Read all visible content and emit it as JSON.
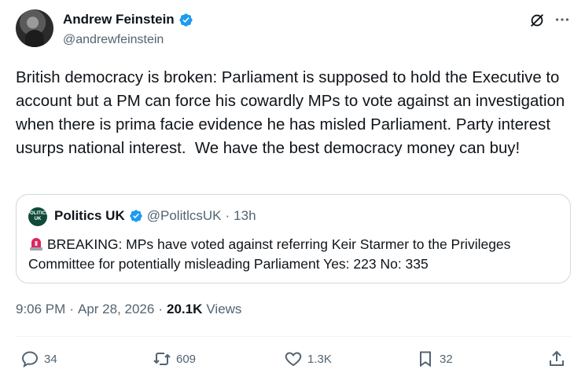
{
  "author": {
    "name": "Andrew Feinstein",
    "handle": "@andrewfeinstein"
  },
  "tweet": {
    "text": "British democracy is broken: Parliament is supposed to hold the Executive to account but a PM can force his cowardly MPs to vote against an investigation when there is prima facie evidence he has misled Parliament. Party interest usurps national interest.  We have the best democracy money can buy!"
  },
  "quote": {
    "avatar_text": "POLITICS UK",
    "name": "Politics UK",
    "handle": "@PolitlcsUK",
    "separator": "·",
    "time": "13h",
    "text": "BREAKING: MPs have voted against referring Keir Starmer to the Privileges Committee for potentially misleading Parliament Yes: 223 No: 335"
  },
  "meta": {
    "time": "9:06 PM",
    "sep1": "·",
    "date": "Apr 28, 2026",
    "sep2": "·",
    "views_count": "20.1K",
    "views_label": "Views"
  },
  "actions": {
    "replies": "34",
    "reposts": "609",
    "likes": "1.3K",
    "bookmarks": "32"
  },
  "icons": [
    "verified-badge-icon",
    "grok-icon",
    "more-icon",
    "siren-icon",
    "reply-icon",
    "repost-icon",
    "like-icon",
    "bookmark-icon",
    "share-icon"
  ],
  "colors": {
    "verified": "#1d9bf0",
    "secondary_text": "#536471",
    "border": "#cfd9de",
    "siren": "#e0245e"
  }
}
